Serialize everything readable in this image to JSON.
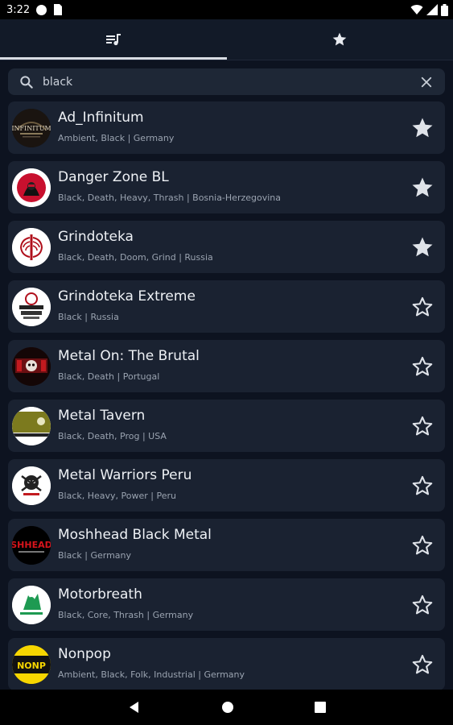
{
  "status": {
    "time": "3:22"
  },
  "tabs": [
    {
      "name": "stations",
      "icon": "playlist-music-icon",
      "active": true
    },
    {
      "name": "favorites",
      "icon": "star-icon",
      "active": false
    }
  ],
  "search": {
    "value": "black",
    "placeholder": ""
  },
  "stations": [
    {
      "name": "Ad_Infinitum",
      "meta": "Ambient, Black | Germany",
      "favorite": true,
      "logo_text": "INFINITUM"
    },
    {
      "name": "Danger Zone BL",
      "meta": "Black, Death, Heavy, Thrash | Bosnia-Herzegovina",
      "favorite": true,
      "logo_text": ""
    },
    {
      "name": "Grindoteka",
      "meta": "Black, Death, Doom, Grind | Russia",
      "favorite": true,
      "logo_text": ""
    },
    {
      "name": "Grindoteka Extreme",
      "meta": "Black | Russia",
      "favorite": false,
      "logo_text": ""
    },
    {
      "name": "Metal On: The Brutal",
      "meta": "Black, Death | Portugal",
      "favorite": false,
      "logo_text": ""
    },
    {
      "name": "Metal Tavern",
      "meta": "Black, Death, Prog | USA",
      "favorite": false,
      "logo_text": ""
    },
    {
      "name": "Metal Warriors Peru",
      "meta": "Black, Heavy, Power | Peru",
      "favorite": false,
      "logo_text": ""
    },
    {
      "name": "Moshhead Black Metal",
      "meta": "Black | Germany",
      "favorite": false,
      "logo_text": "SHHEAD"
    },
    {
      "name": "Motorbreath",
      "meta": "Black, Core, Thrash | Germany",
      "favorite": false,
      "logo_text": ""
    },
    {
      "name": "Nonpop",
      "meta": "Ambient, Black, Folk, Industrial | Germany",
      "favorite": false,
      "logo_text": "NONP"
    }
  ],
  "colors": {
    "background": "#0d1320",
    "card": "#1a2231",
    "accent": "#d7dbe2"
  }
}
